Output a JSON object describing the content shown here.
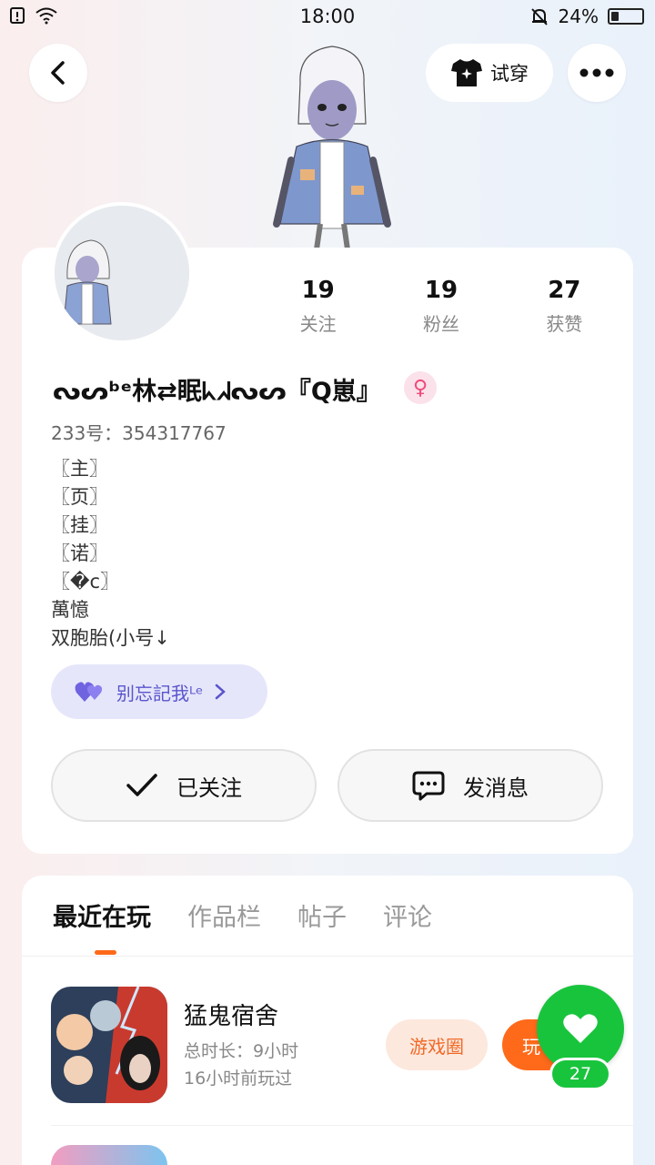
{
  "status_bar": {
    "time": "18:00",
    "battery_percent": "24%",
    "battery_level": 0.24
  },
  "header": {
    "tryon_label": "试穿"
  },
  "profile": {
    "stats": [
      {
        "value": "19",
        "label": "关注"
      },
      {
        "value": "19",
        "label": "粉丝"
      },
      {
        "value": "27",
        "label": "获赞"
      }
    ],
    "nickname": "ᔓᔕᵇᵉ林⇄眠ᖾᖽᔓᔕ『Q崽』",
    "gender_symbol": "♀",
    "user_id": "233号：354317767",
    "bio_lines": [
      "〖主〗",
      "〖页〗",
      "〖挂〗",
      "〖诺〗",
      "〖�c〗",
      "萬憶",
      "双胞胎(小号↓"
    ],
    "club_label": "别忘記我ᴸᵉ",
    "follow_label": "已关注",
    "message_label": "发消息"
  },
  "tabs": [
    {
      "label": "最近在玩",
      "active": true
    },
    {
      "label": "作品栏",
      "active": false
    },
    {
      "label": "帖子",
      "active": false
    },
    {
      "label": "评论",
      "active": false
    }
  ],
  "games": [
    {
      "title": "猛鬼宿舍",
      "total_time": "总时长：9小时",
      "last_played": "16小时前玩过",
      "circle_label": "游戏圈",
      "play_label": "玩"
    }
  ],
  "like": {
    "count": "27"
  },
  "colors": {
    "accent_orange": "#ff6a1a",
    "like_green": "#19c43d",
    "club_purple": "#5a55cc"
  }
}
